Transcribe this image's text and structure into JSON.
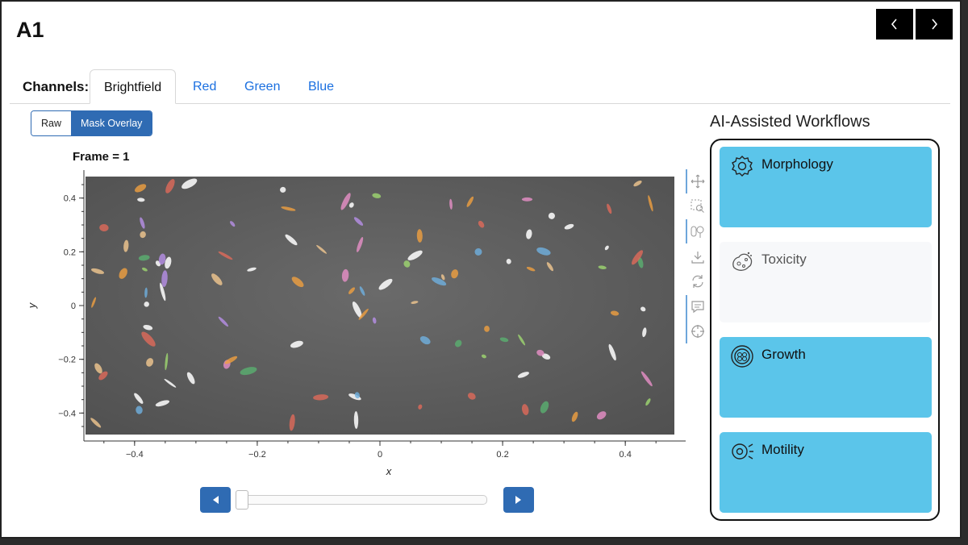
{
  "page": {
    "title": "A1"
  },
  "nav": {
    "prev_icon": "chevron-left-icon",
    "next_icon": "chevron-right-icon"
  },
  "channels": {
    "label": "Channels:",
    "tabs": [
      {
        "label": "Brightfield",
        "active": true
      },
      {
        "label": "Red",
        "active": false
      },
      {
        "label": "Green",
        "active": false
      },
      {
        "label": "Blue",
        "active": false
      }
    ]
  },
  "view_toggle": {
    "options": [
      "Raw",
      "Mask Overlay"
    ],
    "selected": "Mask Overlay"
  },
  "plot": {
    "title": "Frame = 1",
    "xlabel": "x",
    "ylabel": "y",
    "xticks": [
      -0.4,
      -0.2,
      0,
      0.2,
      0.4
    ],
    "yticks": [
      0.4,
      0.2,
      0,
      -0.2,
      -0.4
    ],
    "xtick_labels": [
      "−0.4",
      "−0.2",
      "0",
      "0.2",
      "0.4"
    ],
    "ytick_labels": [
      "0.4",
      "0.2",
      "0",
      "−0.2",
      "−0.4"
    ],
    "xlim": [
      -0.48,
      0.48
    ],
    "ylim": [
      -0.48,
      0.48
    ]
  },
  "toolbar": {
    "tools": [
      "pan-icon",
      "box-zoom-icon",
      "wheel-zoom-icon",
      "save-icon",
      "reset-icon",
      "hover-icon",
      "crosshair-icon"
    ]
  },
  "player": {
    "prev_icon": "step-back-icon",
    "next_icon": "step-forward-icon",
    "frame": 1
  },
  "workflows": {
    "heading": "AI-Assisted Workflows",
    "items": [
      {
        "label": "Morphology",
        "icon": "gear-cell-icon",
        "enabled": true
      },
      {
        "label": "Toxicity",
        "icon": "toxicity-cell-icon",
        "enabled": false
      },
      {
        "label": "Growth",
        "icon": "growth-cell-icon",
        "enabled": true
      },
      {
        "label": "Motility",
        "icon": "motility-cell-icon",
        "enabled": true
      }
    ]
  },
  "colors": {
    "accent": "#2f6bb3",
    "workflow_enabled": "#5bc5ea",
    "tab_link": "#1a6fe0"
  }
}
